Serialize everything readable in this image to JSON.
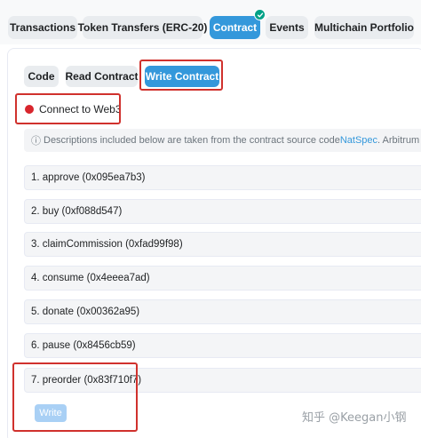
{
  "tabs": [
    {
      "label": "Transactions",
      "active": false
    },
    {
      "label": "Token Transfers (ERC-20)",
      "active": false
    },
    {
      "label": "Contract",
      "active": true,
      "verified_icon": "check-circle-icon"
    },
    {
      "label": "Events",
      "active": false
    },
    {
      "label": "Multichain Portfolio",
      "active": false
    }
  ],
  "subtabs": [
    {
      "label": "Code",
      "active": false
    },
    {
      "label": "Read Contract",
      "active": false
    },
    {
      "label": "Write Contract",
      "active": true
    }
  ],
  "connect": {
    "label": "Connect to Web3",
    "status_color": "#d8262d"
  },
  "info": {
    "icon": "info-circle-icon",
    "text_before": "Descriptions included below are taken from the contract source code ",
    "link": "NatSpec",
    "text_after": ". Arbitrum One do"
  },
  "functions": [
    "1. approve (0x095ea7b3)",
    "2. buy (0xf088d547)",
    "3. claimCommission (0xfad99f98)",
    "4. consume (0x4eeea7ad)",
    "5. donate (0x00362a95)",
    "6. pause (0x8456cb59)",
    "7. preorder (0x83f710f7)"
  ],
  "write_button": {
    "label": "Write"
  },
  "watermark": "知乎 @Keegan小钢",
  "colors": {
    "accent": "#3498db",
    "highlight_box": "#d0312d",
    "verified": "#00a186"
  }
}
